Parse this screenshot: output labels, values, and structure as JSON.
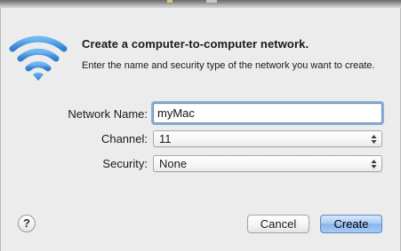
{
  "dialog": {
    "title": "Create a computer-to-computer network.",
    "description": "Enter the name and security type of the network you want to create."
  },
  "form": {
    "network_name": {
      "label": "Network Name:",
      "value": "myMac"
    },
    "channel": {
      "label": "Channel:",
      "value": "11"
    },
    "security": {
      "label": "Security:",
      "value": "None"
    }
  },
  "buttons": {
    "help": "?",
    "cancel": "Cancel",
    "create": "Create"
  },
  "icons": {
    "wifi": "wifi-icon",
    "popup_arrows": "up-down-arrows-icon"
  },
  "colors": {
    "wifi_blue": "#3a8ad8",
    "focus_ring": "#7fb2ee",
    "default_button": "#86b3ea",
    "window_bg": "#ececec"
  }
}
